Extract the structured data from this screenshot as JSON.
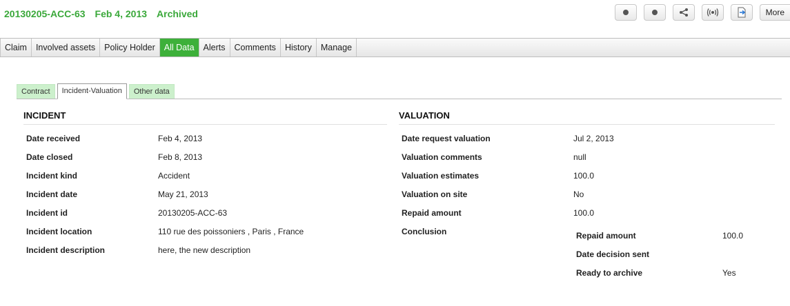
{
  "header": {
    "case_id": "20130205-ACC-63",
    "date": "Feb 4, 2013",
    "status": "Archived",
    "toolbar": {
      "buttons": [
        {
          "icon": "dot-icon"
        },
        {
          "icon": "dot-icon"
        },
        {
          "icon": "share-icon"
        },
        {
          "icon": "broadcast-icon"
        },
        {
          "icon": "export-icon"
        }
      ],
      "more_label": "More"
    }
  },
  "main_tabs": [
    {
      "label": "Claim"
    },
    {
      "label": "Involved assets"
    },
    {
      "label": "Policy Holder"
    },
    {
      "label": "All Data",
      "active": true
    },
    {
      "label": "Alerts"
    },
    {
      "label": "Comments"
    },
    {
      "label": "History"
    },
    {
      "label": "Manage"
    }
  ],
  "sub_tabs": [
    {
      "label": "Contract"
    },
    {
      "label": "Incident-Valuation",
      "active": true
    },
    {
      "label": "Other data"
    }
  ],
  "incident": {
    "title": "INCIDENT",
    "rows": [
      {
        "label": "Date received",
        "value": "Feb 4, 2013"
      },
      {
        "label": "Date closed",
        "value": "Feb 8, 2013"
      },
      {
        "label": "Incident kind",
        "value": "Accident"
      },
      {
        "label": "Incident date",
        "value": "May 21, 2013"
      },
      {
        "label": "Incident id",
        "value": "20130205-ACC-63"
      },
      {
        "label": "Incident location",
        "value": "110 rue des poissoniers , Paris , France"
      },
      {
        "label": "Incident description",
        "value": "here, the new description"
      }
    ]
  },
  "valuation": {
    "title": "VALUATION",
    "rows": [
      {
        "label": "Date request valuation",
        "value": "Jul 2, 2013"
      },
      {
        "label": "Valuation comments",
        "value": "null"
      },
      {
        "label": "Valuation estimates",
        "value": "100.0"
      },
      {
        "label": "Valuation on site",
        "value": "No"
      },
      {
        "label": "Repaid amount",
        "value": "100.0"
      },
      {
        "label": "Conclusion",
        "value": ""
      }
    ],
    "conclusion_rows": [
      {
        "label": "Repaid amount",
        "value": "100.0"
      },
      {
        "label": "Date decision sent",
        "value": ""
      },
      {
        "label": "Ready to archive",
        "value": "Yes"
      }
    ]
  }
}
